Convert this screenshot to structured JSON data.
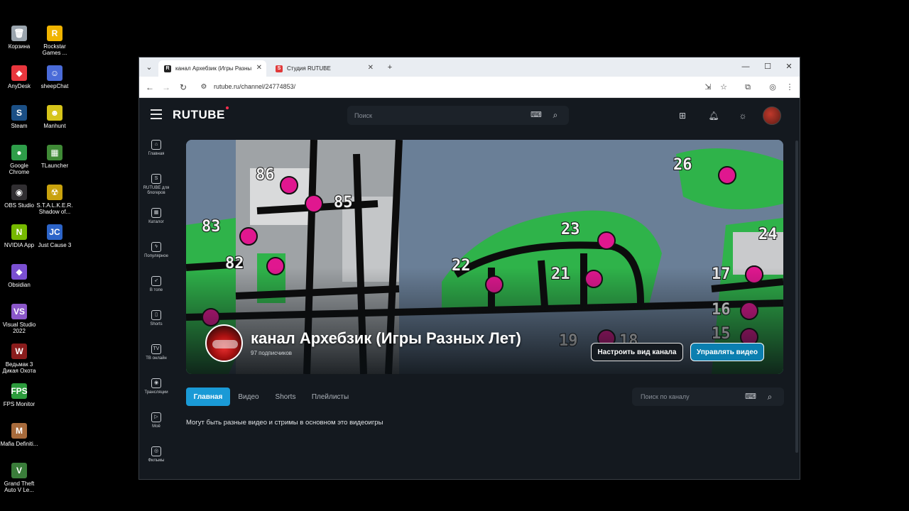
{
  "desktop": {
    "icons": [
      {
        "label": "Корзина",
        "color": "#9aa4ad",
        "glyph": "🗑"
      },
      {
        "label": "Rockstar Games ...",
        "color": "#f0b400",
        "glyph": "R"
      },
      {
        "label": "AnyDesk",
        "color": "#e8363d",
        "glyph": "◆"
      },
      {
        "label": "sheepChat",
        "color": "#4a6bd8",
        "glyph": "☺"
      },
      {
        "label": "Steam",
        "color": "#1b4f85",
        "glyph": "S"
      },
      {
        "label": "Manhunt",
        "color": "#d6c41a",
        "glyph": "☻"
      },
      {
        "label": "Google Chrome",
        "color": "#2e9d49",
        "glyph": "●"
      },
      {
        "label": "TLauncher",
        "color": "#3f8a36",
        "glyph": "▦"
      },
      {
        "label": "OBS Studio",
        "color": "#302e31",
        "glyph": "◉"
      },
      {
        "label": "S.T.A.L.K.E.R. Shadow of...",
        "color": "#c9a20d",
        "glyph": "☢"
      },
      {
        "label": "NVIDIA App",
        "color": "#76b900",
        "glyph": "N"
      },
      {
        "label": "Just Cause 3",
        "color": "#2c64c8",
        "glyph": "JC"
      },
      {
        "label": "Obsidian",
        "color": "#7a4fd1",
        "glyph": "◆"
      },
      {
        "label": "Visual Studio 2022",
        "color": "#8b57c9",
        "glyph": "VS"
      },
      {
        "label": "Ведьмак 3 Дикая Охота",
        "color": "#8a1c1c",
        "glyph": "W"
      },
      {
        "label": "FPS Monitor",
        "color": "#2c9b3c",
        "glyph": "FPS"
      },
      {
        "label": "Mafia Definiti...",
        "color": "#a86b3c",
        "glyph": "M"
      },
      {
        "label": "Grand Theft Auto V Le...",
        "color": "#3a7d3a",
        "glyph": "V"
      }
    ]
  },
  "browser": {
    "tabs": [
      {
        "title": "канал Архебзик (Игры Разны",
        "favicon": "R",
        "favicon_color": "#222"
      },
      {
        "title": "Студия RUTUBE",
        "favicon": "S",
        "favicon_color": "#e03a3a"
      }
    ],
    "new_tab": "+",
    "url": "rutube.ru/channel/24774853/"
  },
  "header": {
    "logo": "RUTUBE",
    "search_placeholder": "Поиск"
  },
  "sidebar": {
    "items": [
      {
        "label": "Главная",
        "icon": "⌂"
      },
      {
        "label": "RUTUBE для блогеров",
        "icon": "S"
      },
      {
        "label": "Каталог",
        "icon": "▦"
      },
      {
        "label": "Популярное",
        "icon": "ϟ"
      },
      {
        "label": "В топе",
        "icon": "➶"
      },
      {
        "label": "Shorts",
        "icon": "▯"
      },
      {
        "label": "ТВ онлайн",
        "icon": "TV"
      },
      {
        "label": "Трансляции",
        "icon": "◉"
      },
      {
        "label": "Моё",
        "icon": "▷"
      },
      {
        "label": "Фильмы",
        "icon": "◎"
      }
    ]
  },
  "channel": {
    "name": "канал Архебзик (Игры Разных Лет)",
    "subscribers": "97 подписчиков",
    "customize_button": "Настроить вид канала",
    "manage_button": "Управлять видео",
    "tabs": [
      "Главная",
      "Видео",
      "Shorts",
      "Плейлисты"
    ],
    "search_placeholder": "Поиск по каналу",
    "description": "Могут быть разные видео и стримы в основном это видеоигры"
  },
  "banner_map": {
    "labels": [
      "86",
      "85",
      "83",
      "82",
      "26",
      "23",
      "22",
      "21",
      "24",
      "17",
      "16",
      "15",
      "19",
      "18"
    ]
  },
  "colors": {
    "accent": "#1a9ad6",
    "page_bg": "#14191f",
    "map_green": "#2fb34a",
    "map_pink": "#e0178f",
    "map_water": "#6a7f97"
  }
}
